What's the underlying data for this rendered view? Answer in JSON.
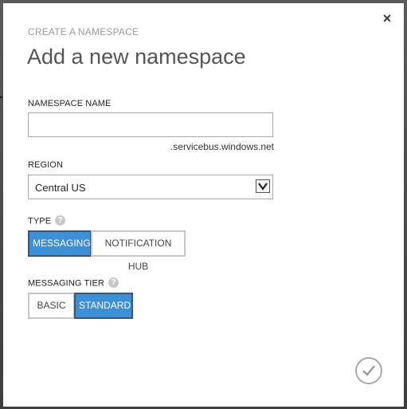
{
  "dialog": {
    "subtitle": "CREATE A NAMESPACE",
    "title": "Add a new namespace",
    "close_glyph": "×"
  },
  "namespace_name": {
    "label": "NAMESPACE NAME",
    "value": "",
    "suffix": ".servicebus.windows.net"
  },
  "region": {
    "label": "REGION",
    "selected": "Central US"
  },
  "type": {
    "label": "TYPE",
    "help_glyph": "?",
    "options": [
      "MESSAGING",
      "NOTIFICATION HUB"
    ],
    "selected": "MESSAGING"
  },
  "messaging_tier": {
    "label": "MESSAGING TIER",
    "help_glyph": "?",
    "options": [
      "BASIC",
      "STANDARD"
    ],
    "selected": "STANDARD"
  },
  "icons": {
    "close": "close-icon",
    "help": "help-icon",
    "dropdown": "chevron-down-icon",
    "confirm": "checkmark-icon"
  },
  "colors": {
    "selected_bg": "#3d8fd6",
    "selected_border": "#2a5a85",
    "title_text": "#555555",
    "subtitle_text": "#9a9a9a"
  }
}
